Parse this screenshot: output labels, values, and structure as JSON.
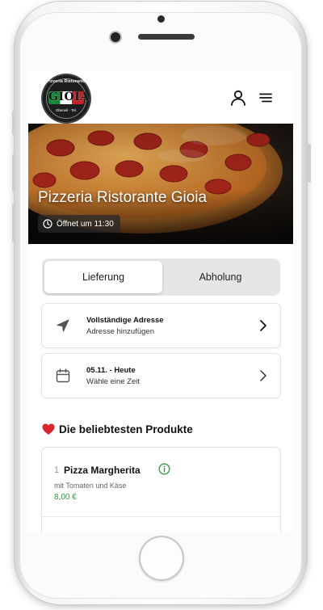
{
  "header": {
    "logo": {
      "top_text": "Pizzeria Ristorante",
      "name": "GIOIA",
      "bottom_text": "Oberwil · Tel."
    },
    "account_icon": "user-icon",
    "menu_icon": "hamburger-menu-icon"
  },
  "hero": {
    "title": "Pizzeria Ristorante Gioia",
    "hours_icon": "clock-icon",
    "hours_label": "Öffnet um 11:30"
  },
  "order_mode": {
    "options": [
      "Lieferung",
      "Abholung"
    ],
    "selected": "Lieferung"
  },
  "address_card": {
    "icon": "navigation-arrow-icon",
    "title": "Vollständige Adresse",
    "subtitle": "Adresse hinzufügen"
  },
  "time_card": {
    "icon": "calendar-icon",
    "title": "05.11. - Heute",
    "subtitle": "Wähle eine Zeit"
  },
  "popular": {
    "icon": "heart-icon",
    "title": "Die beliebtesten Produkte",
    "products": [
      {
        "number": "1",
        "name": "Pizza Margherita",
        "description": "mit Tomaten und Käse",
        "price": "8,00 €"
      }
    ]
  },
  "colors": {
    "accent_green": "#2a9a3a",
    "heart_red": "#d9242b",
    "toggle_bg": "#e6e6e6"
  }
}
